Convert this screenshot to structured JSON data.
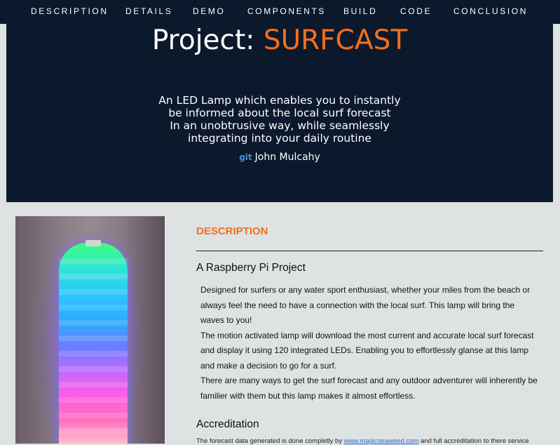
{
  "nav": {
    "items": [
      "DESCRIPTION",
      "DETAILS",
      "DEMO",
      "COMPONENTS",
      "BUILD",
      "CODE",
      "CONCLUSION"
    ]
  },
  "hero": {
    "title_prefix": "Project: ",
    "title_accent": "SURFCAST",
    "tagline": [
      "An LED Lamp which enables you to instantly",
      "be informed about the local surf forecast",
      "In an unobtrusive way, while seamlessly",
      "integrating into your daily routine"
    ],
    "git_label": "git",
    "author": "John Mulcahy"
  },
  "description": {
    "heading": "DESCRIPTION",
    "subheading": "A Raspberry Pi Project",
    "paragraphs": [
      "Designed for surfers or any water sport enthusiast, whether your miles from the beach or always feel the need to have a connection with the local surf. This lamp will bring the waves to you!",
      "The motion activated lamp will download the most current and accurate local surf forecast and display it using 120 integrated LEDs. Enabling you to effortlessly glanse at this lamp and make a decision to go for a surf.",
      "There are many ways to get the surf forecast and any outdoor adventurer will inherently be familier with them but this lamp makes it almost effortless."
    ]
  },
  "accreditation": {
    "heading": "Accreditation",
    "text_before": "The forecast data generated is done completly by ",
    "link": "www.magicseaweed.com",
    "text_after": " and full accreditation to there service"
  },
  "colors": {
    "hero_bg": "#0c192c",
    "accent": "#f36f1e",
    "page_bg": "#dfe2e3",
    "link": "#2a6bd0"
  }
}
